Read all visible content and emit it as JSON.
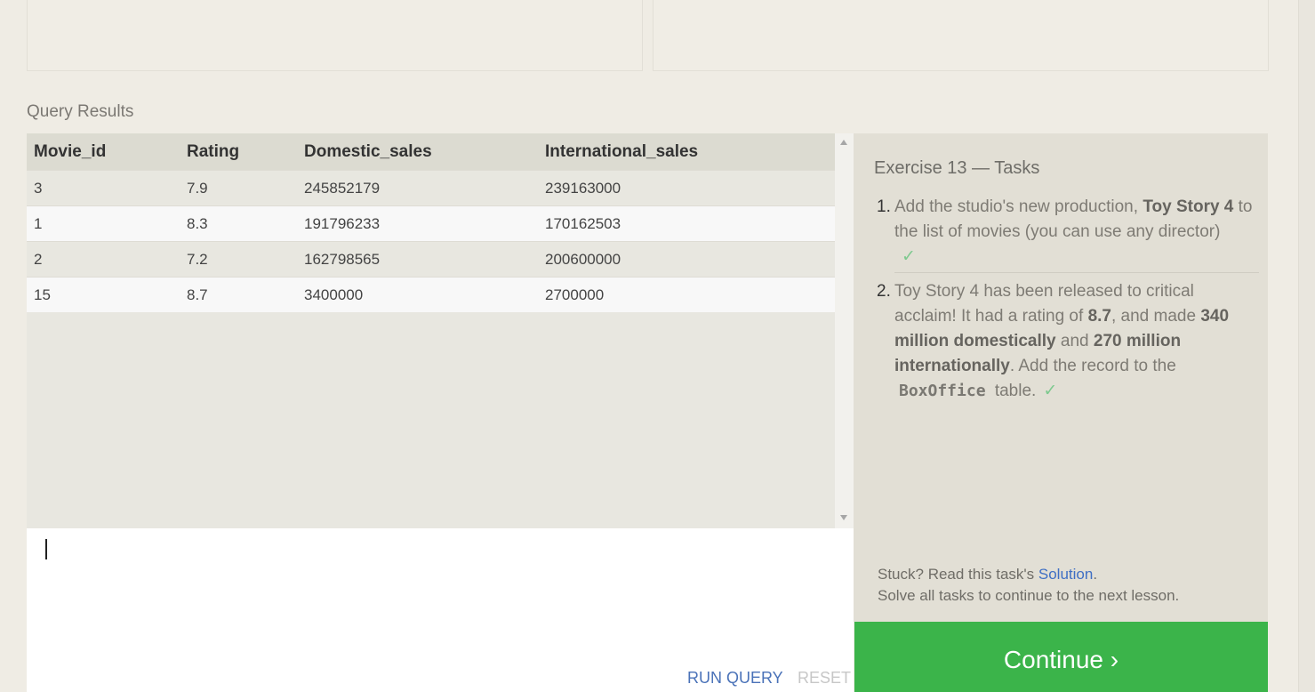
{
  "query_results": {
    "label": "Query Results",
    "columns": [
      "Movie_id",
      "Rating",
      "Domestic_sales",
      "International_sales"
    ],
    "rows": [
      [
        "3",
        "7.9",
        "245852179",
        "239163000"
      ],
      [
        "1",
        "8.3",
        "191796233",
        "170162503"
      ],
      [
        "2",
        "7.2",
        "162798565",
        "200600000"
      ],
      [
        "15",
        "8.7",
        "3400000",
        "2700000"
      ]
    ]
  },
  "editor": {
    "run_query_label": "RUN QUERY",
    "reset_label": "RESET"
  },
  "tasks": {
    "title": "Exercise 13 — Tasks",
    "items": [
      {
        "number": "1.",
        "parts": [
          "Add the studio's new production, ",
          "Toy Story 4",
          " to the list of movies (you can use any director)"
        ],
        "check": "✓"
      },
      {
        "number": "2.",
        "parts": [
          "Toy Story 4 has been released to critical acclaim! It had a rating of ",
          "8.7",
          ", and made ",
          "340 million domestically",
          " and ",
          "270 million internationally",
          ". Add the record to the ",
          "BoxOffice",
          " table."
        ],
        "check": "✓"
      }
    ],
    "stuck_prefix": "Stuck? Read this task's ",
    "solution_link": "Solution",
    "stuck_suffix": ".",
    "solve_all_text": "Solve all tasks to continue to the next lesson."
  },
  "continue": {
    "label": "Continue ›"
  },
  "colors": {
    "continue_button": "#3bb44a",
    "link": "#3f6fc4",
    "check": "#7ec98f"
  }
}
